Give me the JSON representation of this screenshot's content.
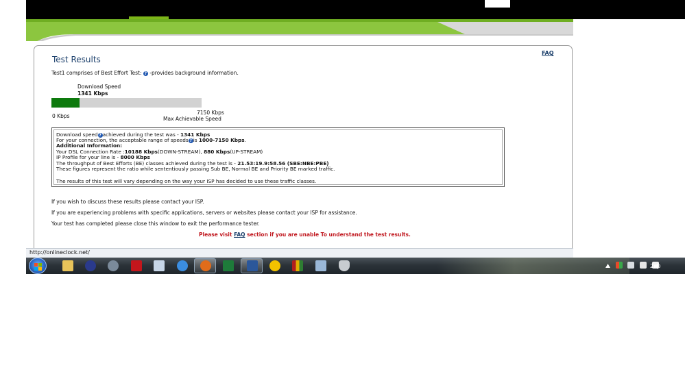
{
  "page": {
    "title": "Test Results",
    "faq_link": "FAQ",
    "intro": {
      "before": "Test1 comprises of Best Effort Test: ",
      "after": " -provides background information."
    },
    "download": {
      "label": "Download Speed",
      "value": "1341 Kbps",
      "min_label": "0 Kbps",
      "max_value": "7150 Kbps",
      "max_label": "Max Achievable Speed",
      "progress_fraction": 0.1876
    },
    "info": {
      "line1_a": "Download speed",
      "line1_b": "achieved during the test was - ",
      "line1_val": "1341 Kbps",
      "line2_a": "For your connection, the acceptable range of speeds",
      "line2_b": "is ",
      "line2_val": "1000-7150 Kbps",
      "line2_end": ".",
      "line3": "Additional Information:",
      "line4_a": "Your DSL Connection Rate :",
      "line4_v1": "10188 Kbps",
      "line4_b": "(DOWN-STREAM), ",
      "line4_v2": "880 Kbps",
      "line4_c": "(UP-STREAM)",
      "line5_a": "IP Profile for your line is - ",
      "line5_val": "8000 Kbps",
      "line6_a": "The throughput of Best Efforts (BE) classes achieved during the test is - ",
      "line6_val": "21.53:19.9:58.56 (SBE:NBE:PBE)",
      "line7": "These figures represent the ratio while sententiously passing Sub BE, Normal BE and Priority BE marked traffic.",
      "line8": "The results of this test will vary depending on the way your ISP has decided to use these traffic classes."
    },
    "paragraphs": [
      "If you wish to discuss these results please contact your ISP.",
      "If you are experiencing problems with specific applications, servers or websites please contact your ISP for assistance.",
      "Your test has completed please close this window to exit the performance tester."
    ],
    "notice": {
      "before": "Please visit ",
      "link": "FAQ",
      "after": " section if you are unable To understand the test results."
    }
  },
  "statusbar": {
    "url": "http://onlineclock.net/"
  },
  "taskbar": {
    "clock": "22:",
    "icons": [
      "explorer-icon",
      "media-icon",
      "network-icon",
      "kaspersky-icon",
      "document-icon",
      "internet-explorer-icon",
      "firefox-icon",
      "excel-icon",
      "word-icon",
      "money-icon",
      "library-icon",
      "photo-icon",
      "shield-icon"
    ]
  },
  "colors": {
    "progress_fill": "#0d7a0d",
    "progress_track": "#d2d2d2",
    "banner_green": "#8cc63f",
    "title_blue": "#1b3f6b",
    "notice_red": "#c0161d"
  }
}
